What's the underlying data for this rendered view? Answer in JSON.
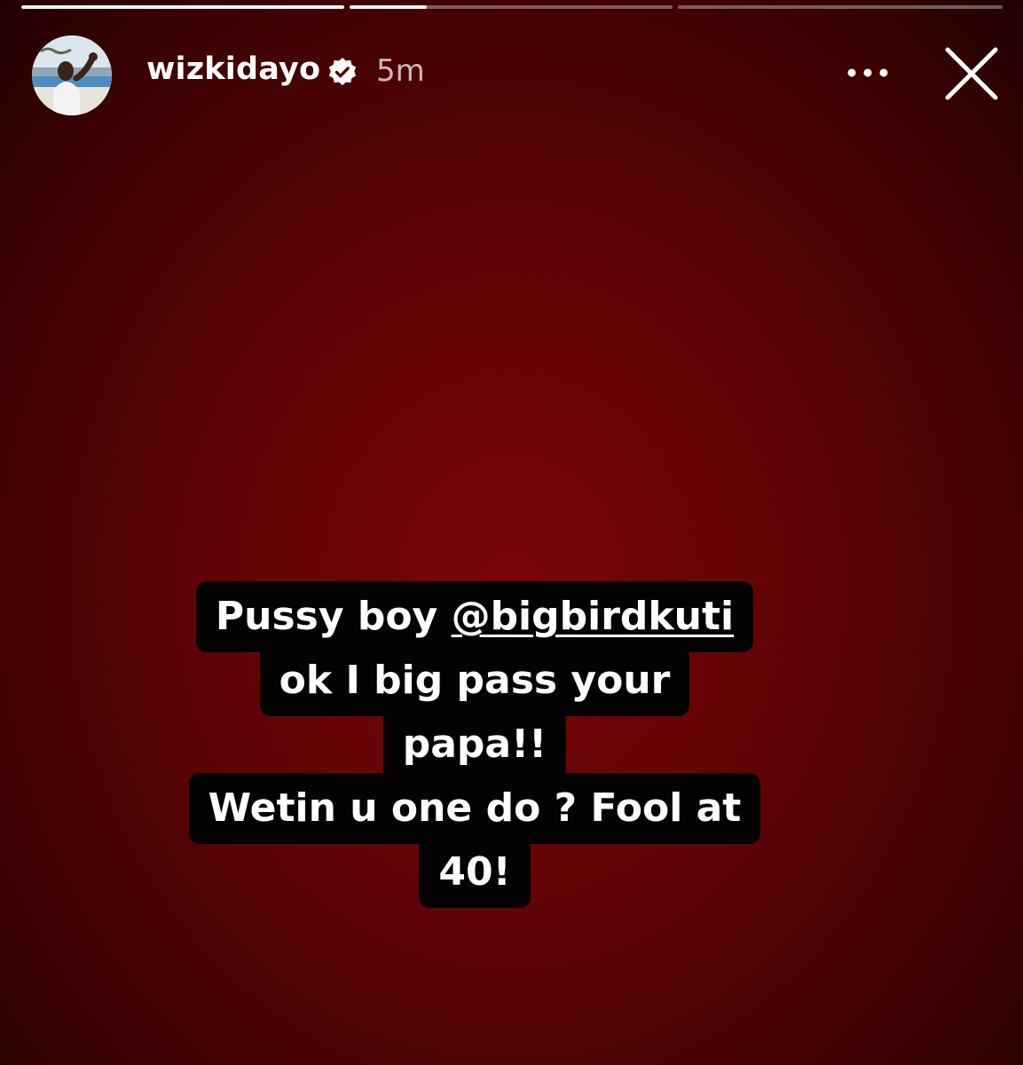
{
  "story": {
    "progress": {
      "segments": [
        {
          "state": "viewed",
          "fill": 1.0
        },
        {
          "state": "current",
          "fill": 0.24
        },
        {
          "state": "upcoming",
          "fill": 0.0
        }
      ]
    },
    "header": {
      "username": "wizkidayo",
      "verified": true,
      "timestamp": "5m",
      "more_icon": "more-dots-icon",
      "close_icon": "close-icon"
    },
    "caption": {
      "line1_prefix": "Pussy boy ",
      "line1_mention": "@bigbirdkuti",
      "line2": "ok I big pass your",
      "line3": "papa!!",
      "line4": "Wetin u one do ? Fool at",
      "line5": "40!"
    },
    "colors": {
      "background": "#5c0306",
      "caption_background": "#050203",
      "text": "#ffffff"
    }
  }
}
